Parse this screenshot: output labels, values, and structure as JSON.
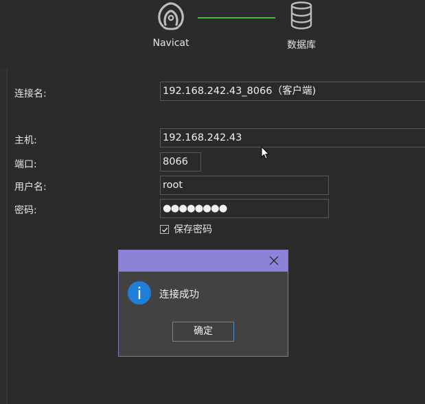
{
  "header": {
    "app_label": "Navicat",
    "db_label": "数据库",
    "link_color": "#3cc23c",
    "app_icon": "navicat-logo-icon",
    "db_icon": "database-icon"
  },
  "form": {
    "conn_name": {
      "label": "连接名:",
      "value": "192.168.242.43_8066（客户端)"
    },
    "host": {
      "label": "主机:",
      "value": "192.168.242.43"
    },
    "port": {
      "label": "端口:",
      "value": "8066"
    },
    "username": {
      "label": "用户名:",
      "value": "root"
    },
    "password": {
      "label": "密码:",
      "value": "●●●●●●●●"
    },
    "save_password": {
      "label": "保存密码",
      "checked": true
    }
  },
  "dialog": {
    "message": "连接成功",
    "ok_label": "确定",
    "icon": "info-icon",
    "titlebar_color": "#8c82d6"
  }
}
